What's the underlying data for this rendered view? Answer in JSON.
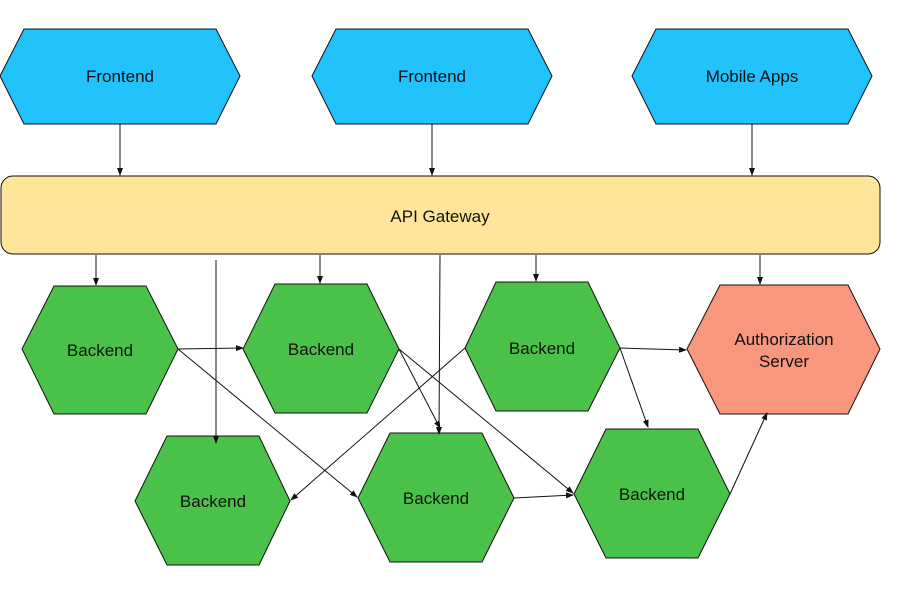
{
  "colors": {
    "client": "#22C2FD",
    "gateway": "#FFE599",
    "backend": "#4AC24A",
    "auth": "#F8967E",
    "stroke": "#111111"
  },
  "nodes": {
    "frontend_1": {
      "label": "Frontend"
    },
    "frontend_2": {
      "label": "Frontend"
    },
    "mobile_apps": {
      "label": "Mobile Apps"
    },
    "api_gateway": {
      "label": "API Gateway"
    },
    "backend_1": {
      "label": "Backend"
    },
    "backend_2": {
      "label": "Backend"
    },
    "backend_3": {
      "label": "Backend"
    },
    "auth_server": {
      "label_line1": "Authorization",
      "label_line2": "Server"
    },
    "backend_4": {
      "label": "Backend"
    },
    "backend_5": {
      "label": "Backend"
    },
    "backend_6": {
      "label": "Backend"
    }
  },
  "edges": [
    {
      "from": "frontend_1",
      "to": "api_gateway"
    },
    {
      "from": "frontend_2",
      "to": "api_gateway"
    },
    {
      "from": "mobile_apps",
      "to": "api_gateway"
    },
    {
      "from": "api_gateway",
      "to": "backend_1"
    },
    {
      "from": "api_gateway",
      "to": "backend_2"
    },
    {
      "from": "api_gateway",
      "to": "backend_3"
    },
    {
      "from": "api_gateway",
      "to": "auth_server"
    },
    {
      "from": "api_gateway",
      "to": "backend_4"
    },
    {
      "from": "api_gateway",
      "to": "backend_5"
    },
    {
      "from": "backend_1",
      "to": "backend_2"
    },
    {
      "from": "backend_1",
      "to": "backend_5"
    },
    {
      "from": "backend_2",
      "to": "backend_5"
    },
    {
      "from": "backend_2",
      "to": "backend_6"
    },
    {
      "from": "backend_3",
      "to": "backend_4"
    },
    {
      "from": "backend_3",
      "to": "auth_server"
    },
    {
      "from": "backend_3",
      "to": "backend_6"
    },
    {
      "from": "backend_5",
      "to": "backend_6"
    },
    {
      "from": "backend_6",
      "to": "auth_server"
    }
  ]
}
